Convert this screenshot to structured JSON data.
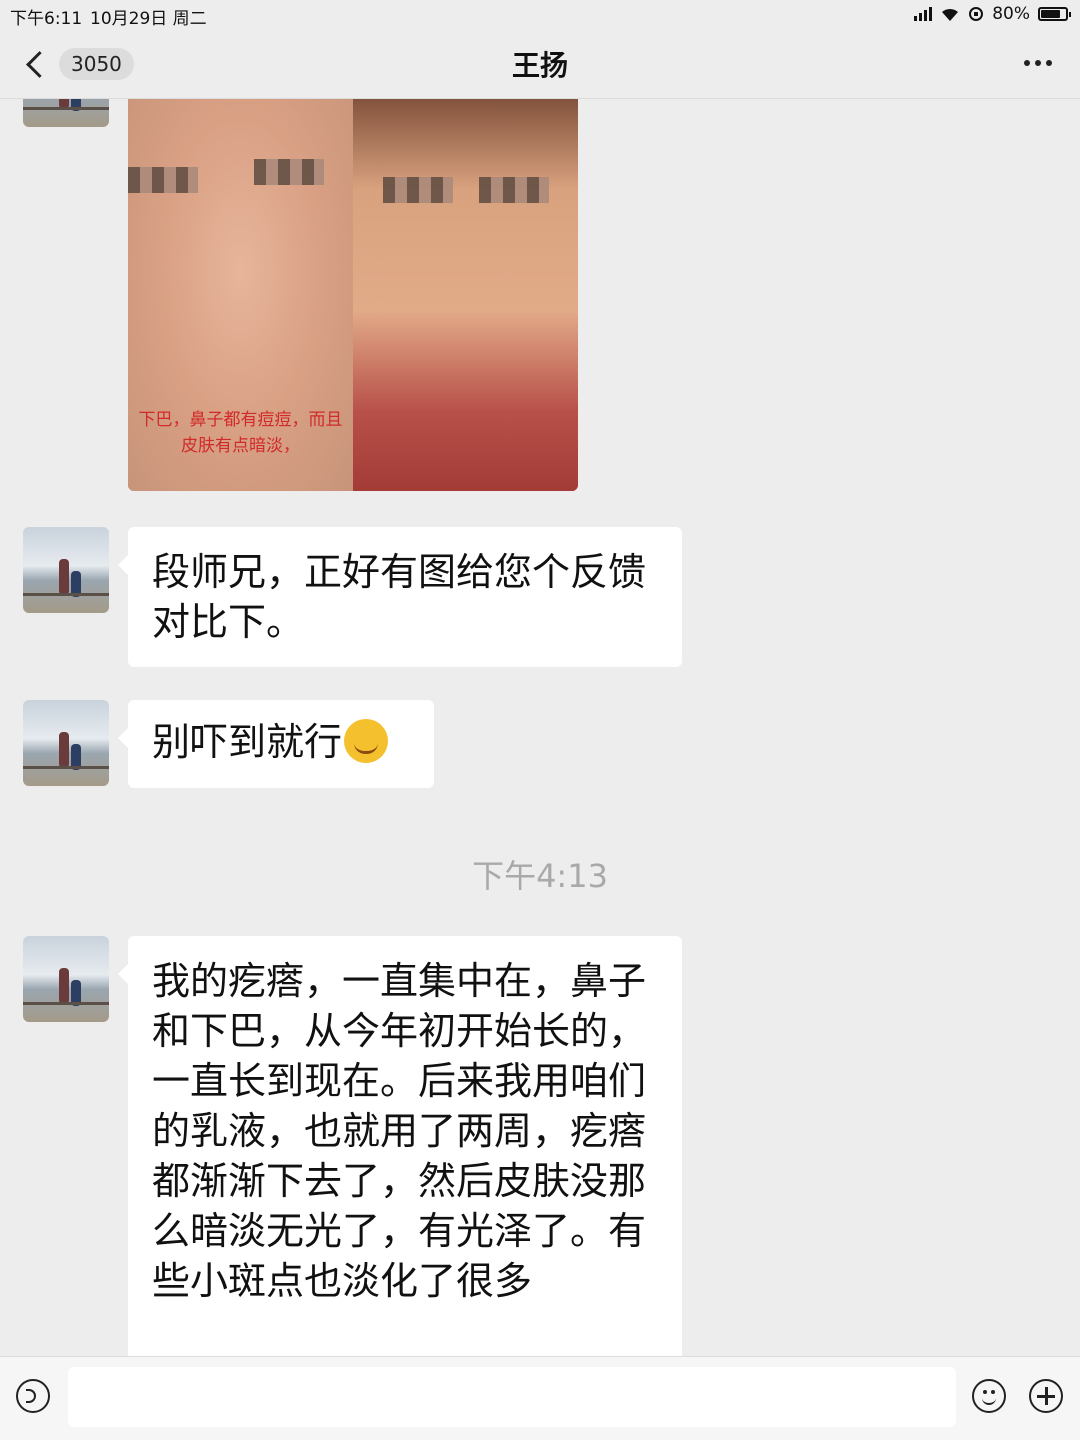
{
  "status_bar": {
    "time": "下午6:11",
    "date": "10月29日 周二",
    "battery": "80%",
    "battery_level": 0.8
  },
  "nav": {
    "unread_count": "3050",
    "title": "王扬"
  },
  "messages": [
    {
      "type": "image",
      "caption": "下巴，鼻子都有痘痘，而且 皮肤有点暗淡，"
    },
    {
      "type": "text",
      "text": "段师兄，正好有图给您个反馈对比下。"
    },
    {
      "type": "text",
      "text": "别吓到就行",
      "emoji": "facepalm-emoji"
    },
    {
      "type": "text",
      "text": "我的疙瘩，一直集中在，鼻子和下巴，从今年初开始长的，一直长到现在。后来我用咱们的乳液，也就用了两周，疙瘩都渐渐下去了，然后皮肤没那么暗淡无光了，有光泽了。有些小斑点也淡化了很多"
    }
  ],
  "timestamp": "下午4:13",
  "input_bar": {
    "placeholder": ""
  },
  "colors": {
    "background": "#ededed",
    "bubble": "#ffffff",
    "caption_red": "#d12a2a"
  }
}
